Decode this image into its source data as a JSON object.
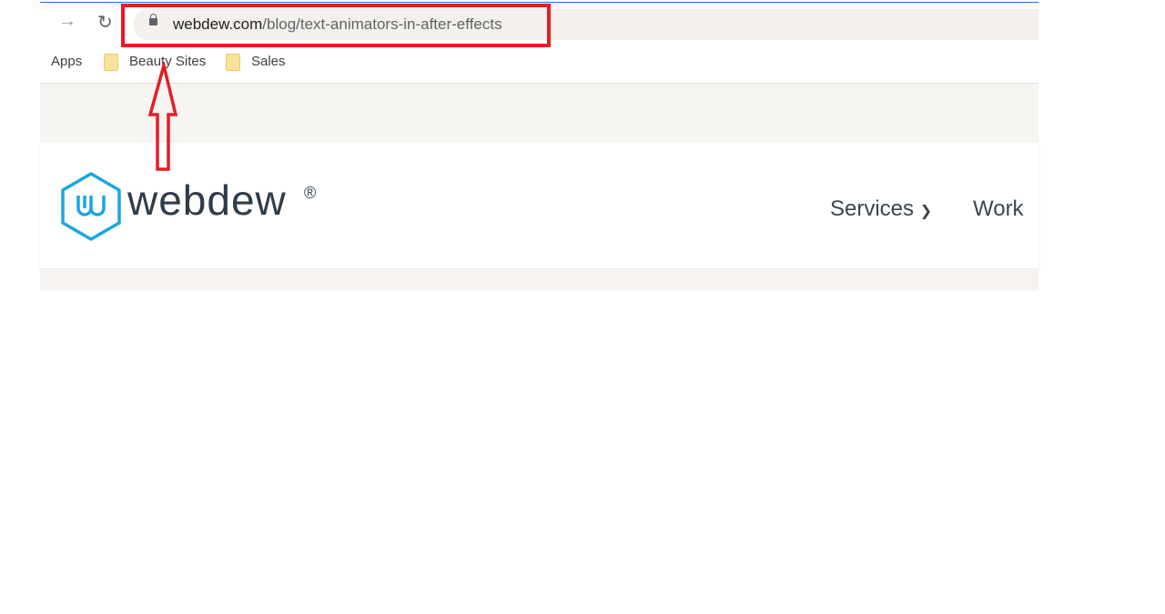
{
  "browser": {
    "url_domain": "webdew.com",
    "url_path": "/blog/text-animators-in-after-effects",
    "forward_icon": "arrow-right-icon",
    "reload_icon": "reload-icon",
    "lock_icon": "lock-icon",
    "bookmarks": [
      {
        "label": "Apps"
      },
      {
        "label": "Beauty Sites",
        "icon": "folder-icon"
      },
      {
        "label": "Sales",
        "icon": "folder-icon"
      }
    ]
  },
  "site": {
    "brand": "webdew",
    "registered": "®",
    "nav": [
      {
        "label": "Services",
        "icon": "chevron-down-icon"
      },
      {
        "label": "Work"
      }
    ]
  },
  "annotation": {
    "color": "#e41e26"
  }
}
